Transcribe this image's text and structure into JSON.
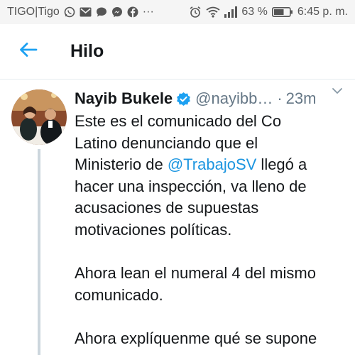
{
  "status_bar": {
    "carrier": "TIGO|Tigo",
    "overflow": "···",
    "battery": "63 %",
    "time": "6:45 p. m.",
    "icons": [
      "whatsapp-icon",
      "gmail-icon",
      "chat-icon",
      "messenger-icon",
      "facebook-icon",
      "alarm-icon",
      "wifi-icon",
      "signal-icon",
      "battery-icon"
    ]
  },
  "header": {
    "title": "Hilo",
    "back_icon": "arrow-left-icon",
    "accent_color": "#1da1f2"
  },
  "tweet": {
    "author": "Nayib Bukele",
    "handle": "@nayibb…",
    "separator": "·",
    "time": "23m",
    "verified": true,
    "lines": {
      "l1": "Este es el comunicado del Co",
      "l2": "Latino denunciando que el",
      "l3_pre": "Ministerio de ",
      "l3_mention": "@TrabajoSV",
      "l3_post": " llegó a",
      "l4": "hacer una inspección, va lleno de",
      "l5": "acusaciones de supuestas",
      "l6": "motivaciones políticas.",
      "l7": "Ahora lean el numeral 4 del mismo",
      "l8": "comunicado.",
      "l9": "Ahora explíquenme qué se supone"
    },
    "mention_color": "#1b95e0"
  }
}
